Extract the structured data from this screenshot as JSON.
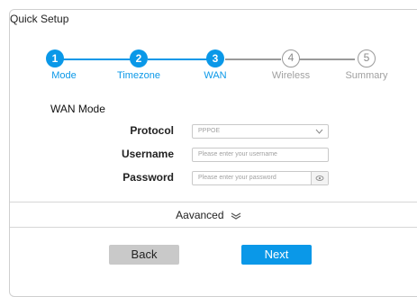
{
  "window": {
    "title": "Quick Setup"
  },
  "stepper": {
    "steps": [
      {
        "number": "1",
        "label": "Mode",
        "state": "done"
      },
      {
        "number": "2",
        "label": "Timezone",
        "state": "done"
      },
      {
        "number": "3",
        "label": "WAN",
        "state": "current"
      },
      {
        "number": "4",
        "label": "Wireless",
        "state": "pending"
      },
      {
        "number": "5",
        "label": "Summary",
        "state": "pending"
      }
    ]
  },
  "wan": {
    "section_title": "WAN Mode",
    "protocol": {
      "label": "Protocol",
      "value": "PPPOE"
    },
    "username": {
      "label": "Username",
      "placeholder": "Please enter your username"
    },
    "password": {
      "label": "Password",
      "placeholder": "Please enter your password"
    }
  },
  "advanced": {
    "label": "Aavanced",
    "icon": "double-chevron-down-icon"
  },
  "buttons": {
    "back": "Back",
    "next": "Next"
  },
  "colors": {
    "accent": "#0a98e8",
    "inactive": "#9a9a9a",
    "back_button": "#c9c9c9"
  }
}
